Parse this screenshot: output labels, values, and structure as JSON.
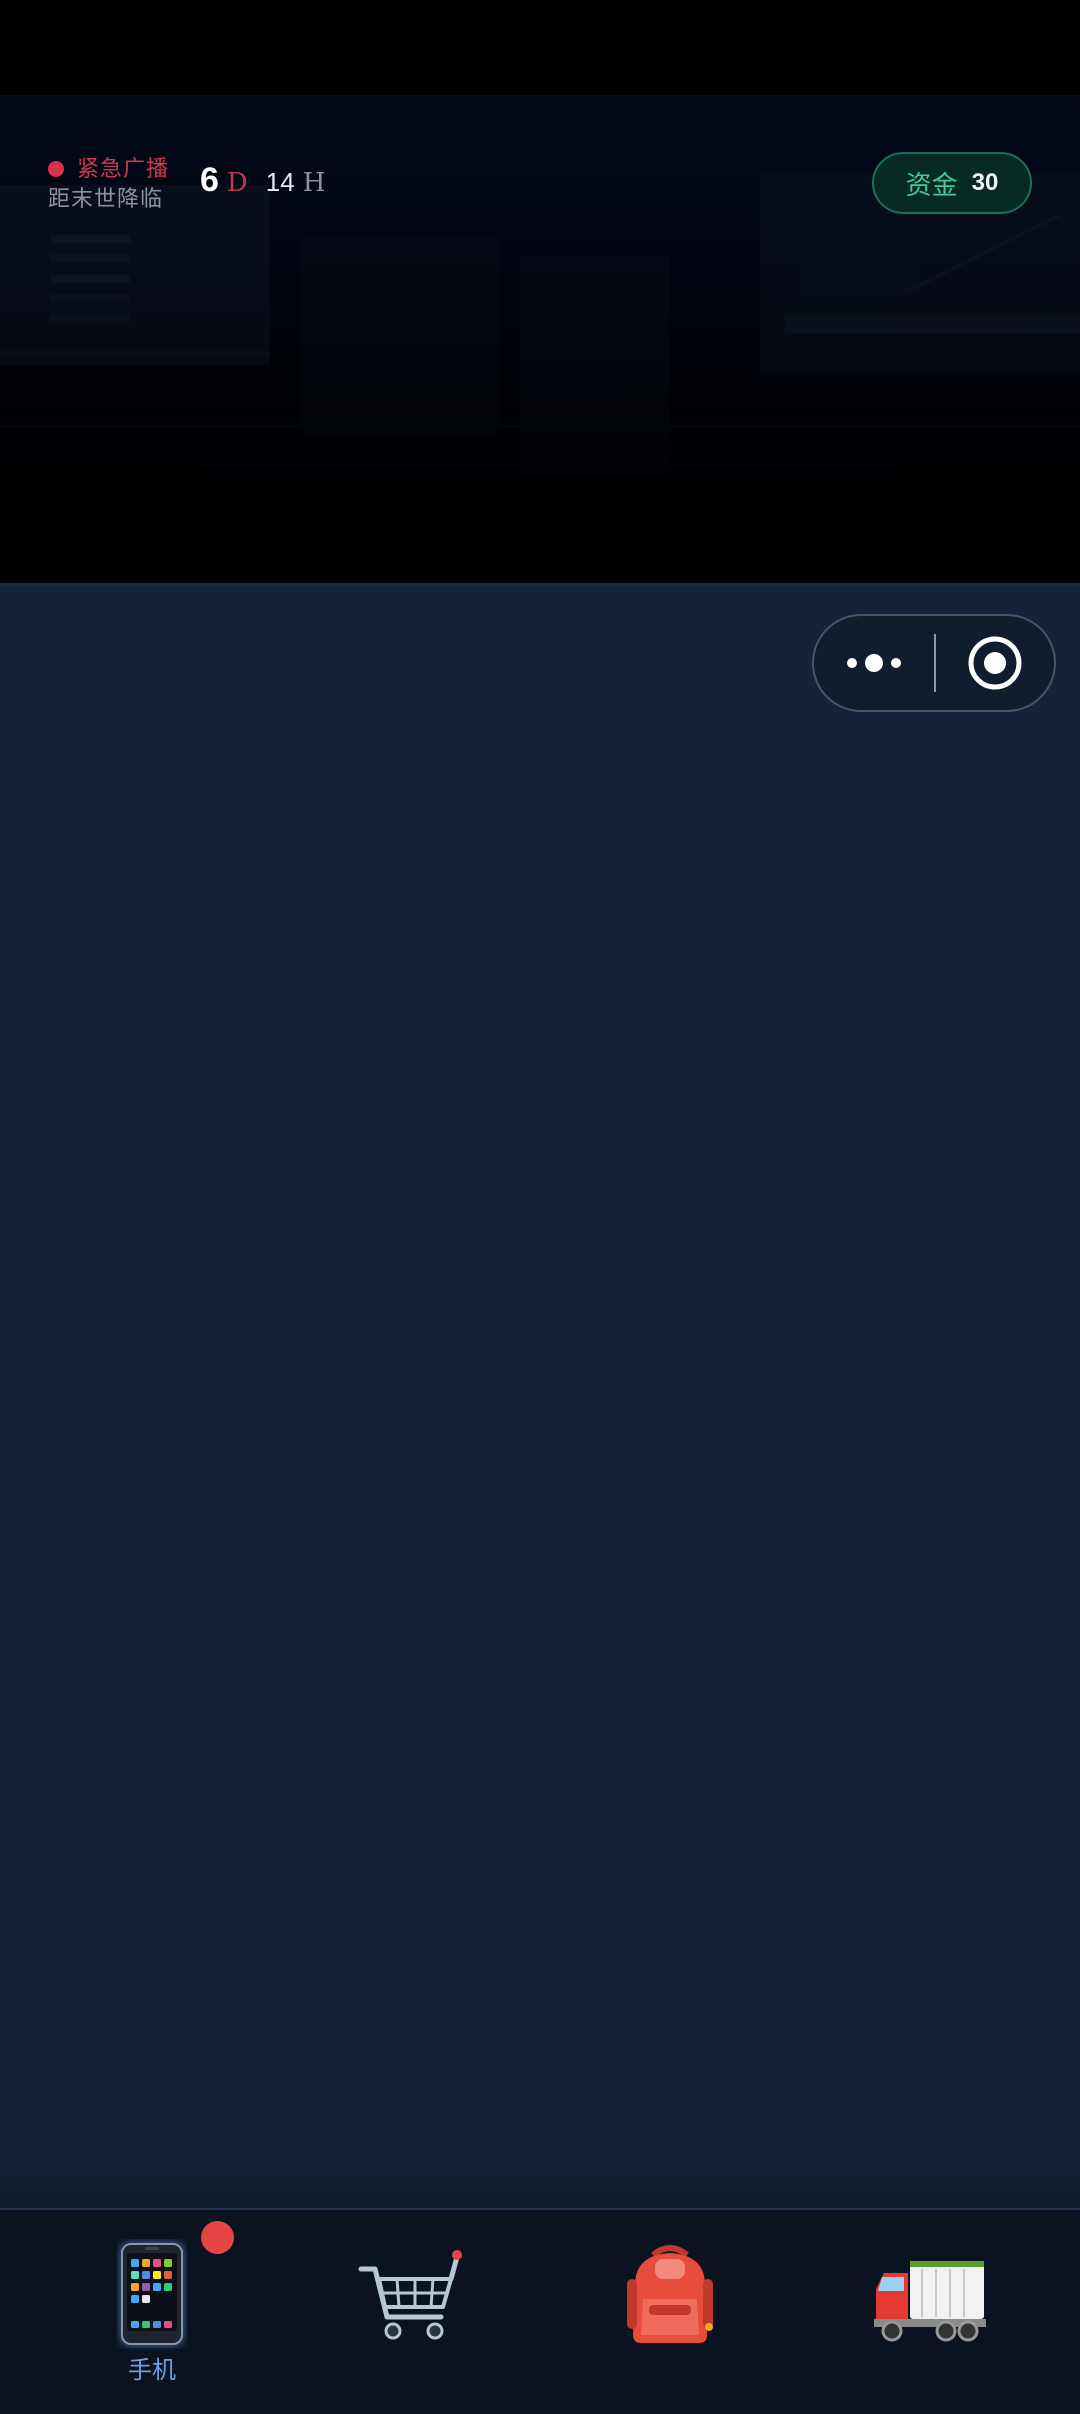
{
  "header": {
    "alert_title": "紧急广播",
    "alert_subtitle": "距末世降临",
    "countdown": {
      "days": "6",
      "days_unit": "D",
      "hours": "14",
      "hours_unit": "H"
    },
    "funds": {
      "label": "资金",
      "value": "30"
    }
  },
  "mini_program_capsule": {
    "more_icon": "more-dots-icon",
    "close_icon": "target-close-icon"
  },
  "bottom_nav": {
    "items": [
      {
        "label": "手机",
        "icon": "mobile-phone-icon",
        "active": true,
        "has_notification": true
      },
      {
        "label": "",
        "icon": "shopping-cart-icon",
        "active": false
      },
      {
        "label": "",
        "icon": "backpack-icon",
        "active": false
      },
      {
        "label": "",
        "icon": "delivery-truck-icon",
        "active": false
      }
    ]
  },
  "colors": {
    "background": "#15233a",
    "alert_red": "#c93a4d",
    "funds_green": "#47c79a",
    "nav_active": "#6f9fe0",
    "notification": "#e64545"
  }
}
